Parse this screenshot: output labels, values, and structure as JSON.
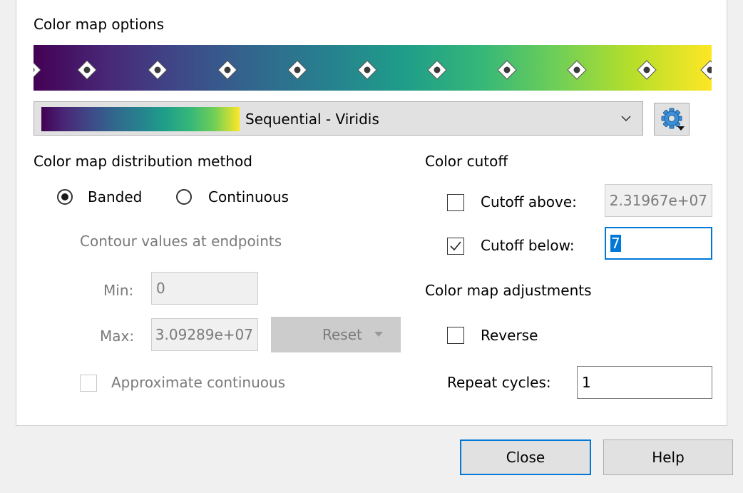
{
  "section_title": "Color map options",
  "colormap": {
    "name": "Sequential - Viridis",
    "stops": [
      "#440154",
      "#482878",
      "#3e4a89",
      "#31688e",
      "#26828e",
      "#1f9e89",
      "#35b779",
      "#6ece58",
      "#b5de2b",
      "#fde725"
    ]
  },
  "distribution": {
    "title": "Color map distribution method",
    "banded_label": "Banded",
    "continuous_label": "Continuous",
    "selected": "Banded",
    "contour_label": "Contour values at endpoints",
    "min_label": "Min:",
    "min_value": "0",
    "max_label": "Max:",
    "max_value": "3.09289e+07",
    "reset_label": "Reset",
    "approx_label": "Approximate continuous"
  },
  "cutoff": {
    "title": "Color cutoff",
    "above_label": "Cutoff above:",
    "above_value": "2.31967e+07",
    "above_checked": false,
    "below_label": "Cutoff below:",
    "below_value": "7",
    "below_checked": true
  },
  "adjustments": {
    "title": "Color map adjustments",
    "reverse_label": "Reverse",
    "reverse_checked": false,
    "repeat_label": "Repeat cycles:",
    "repeat_value": "1"
  },
  "footer": {
    "close_label": "Close",
    "help_label": "Help"
  }
}
